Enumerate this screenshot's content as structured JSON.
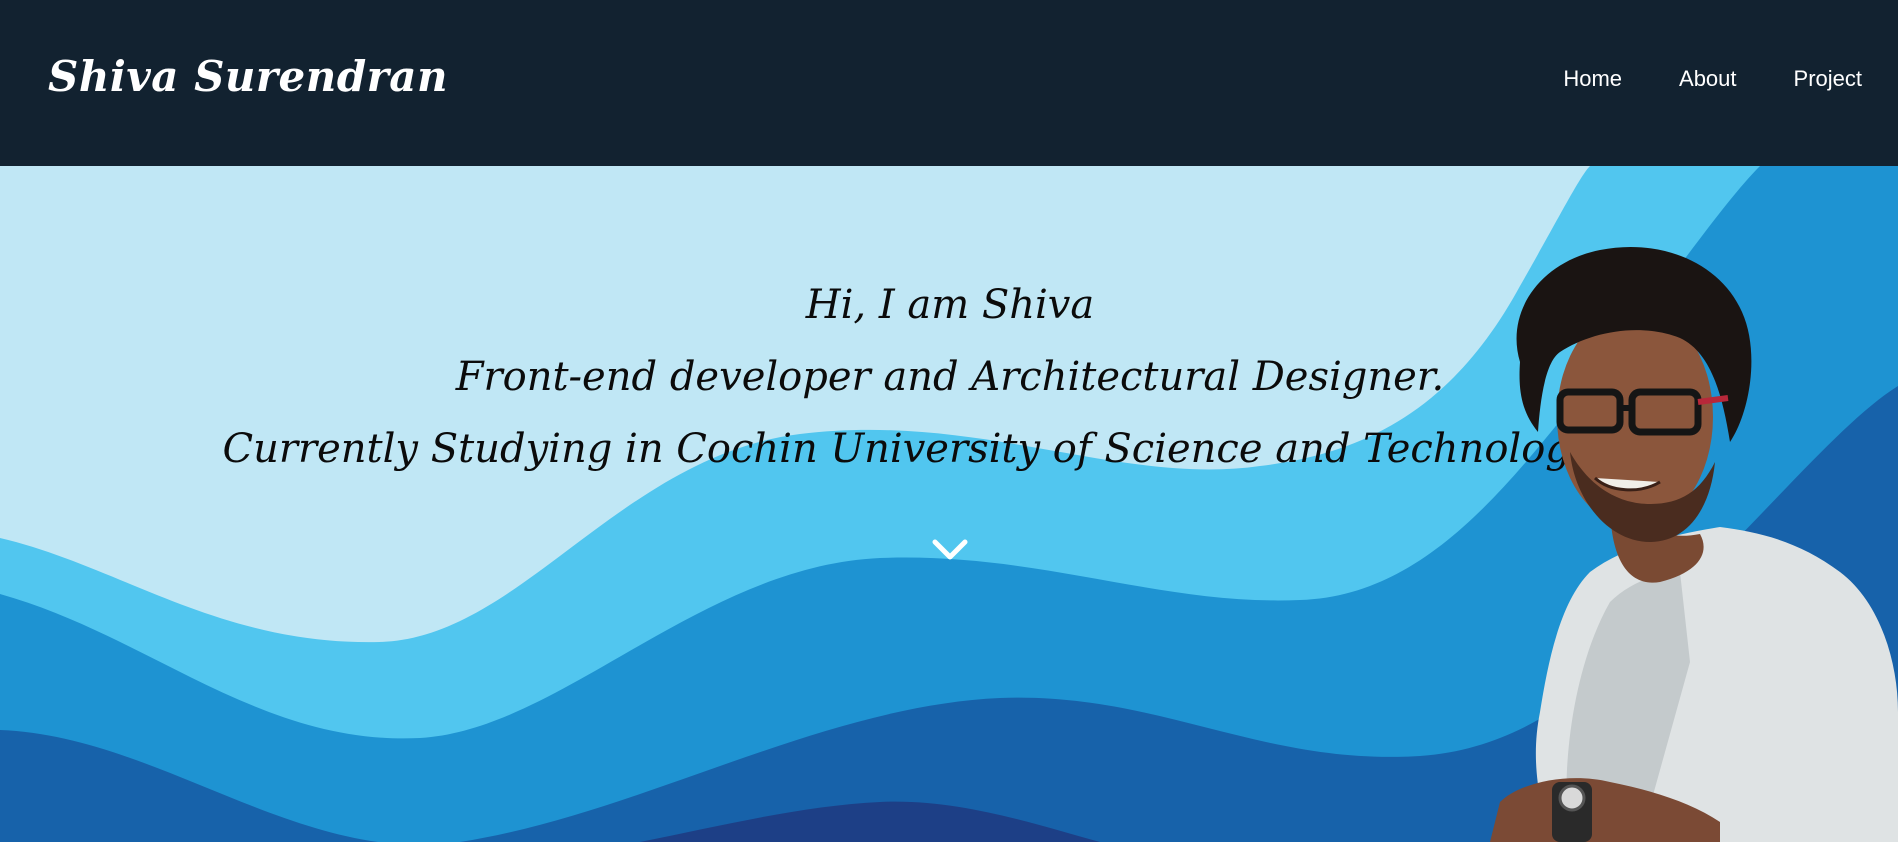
{
  "brand": {
    "name": "Shiva Surendran"
  },
  "nav": {
    "items": [
      {
        "label": "Home"
      },
      {
        "label": "About"
      },
      {
        "label": "Project"
      }
    ]
  },
  "hero": {
    "line1": "Hi, I am Shiva",
    "line2": "Front-end developer and Architectural Designer.",
    "line3": "Currently Studying in Cochin University of Science and Technology",
    "scroll_icon": "chevron-down-icon"
  },
  "colors": {
    "navbar": "#122230",
    "wave_light": "#c0e7f5",
    "wave_sky": "#51c6ef",
    "wave_mid": "#1e93d2",
    "wave_deep": "#1762aa",
    "wave_navy": "#1d3f86"
  }
}
